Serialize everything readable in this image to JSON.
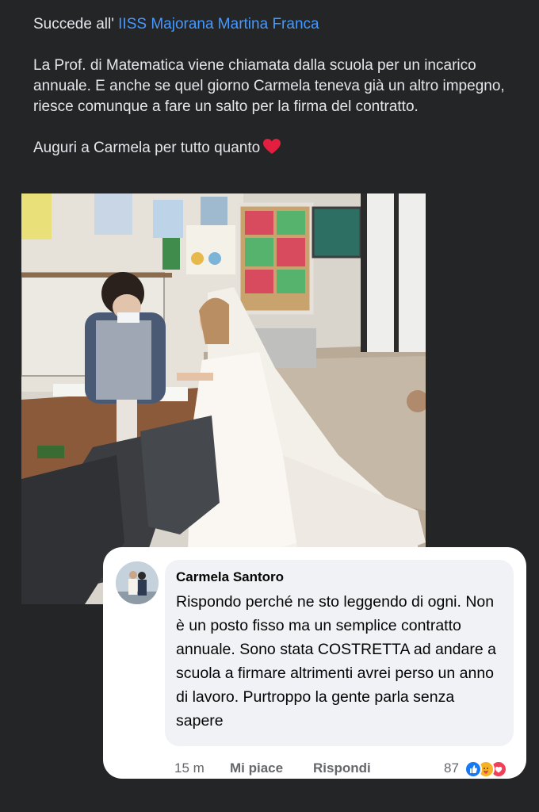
{
  "post": {
    "line1_prefix": "Succede all' ",
    "line1_link": "IISS Majorana Martina Franca",
    "paragraph2": "La Prof. di Matematica viene chiamata dalla scuola per un incarico annuale. E anche se quel giorno Carmela teneva già un altro impegno, riesce comunque a fare un salto per la firma del contratto.",
    "paragraph3": "Auguri a Carmela per tutto quanto",
    "heart_icon": "red-heart-emoji"
  },
  "comment": {
    "author": "Carmela Santoro",
    "text": "Rispondo perché ne sto leggendo di ogni. Non è un posto fisso ma un semplice contratto annuale. Sono stata COSTRETTA ad andare a scuola a firmare altrimenti avrei perso un anno di lavoro. Purtroppo la gente parla senza sapere",
    "time": "15 m",
    "like_label": "Mi piace",
    "reply_label": "Rispondi",
    "reaction_count": "87",
    "reaction_icons": [
      "like-icon",
      "care-icon",
      "love-icon"
    ]
  },
  "colors": {
    "background": "#242526",
    "text": "#e4e6eb",
    "link": "#4599ff",
    "card": "#ffffff",
    "bubble": "#f0f2f5"
  }
}
